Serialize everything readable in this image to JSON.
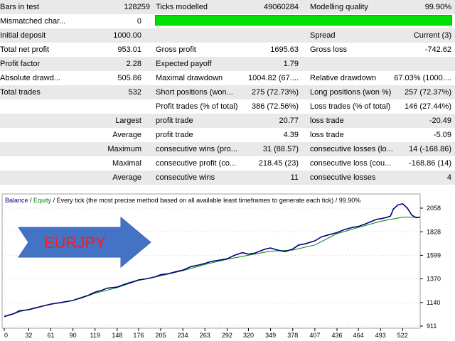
{
  "report": {
    "rows": [
      {
        "cells": [
          {
            "text": "Bars in test",
            "x": 0,
            "w": 200,
            "align": "l"
          },
          {
            "text": "128259",
            "x": 140,
            "w": 71,
            "align": "r"
          },
          {
            "text": "Ticks modelled",
            "x": 219,
            "w": 200,
            "align": "l"
          },
          {
            "text": "49060284",
            "x": 330,
            "w": 90,
            "align": "r"
          },
          {
            "text": "Modelling quality",
            "x": 436,
            "w": 200,
            "align": "l"
          },
          {
            "text": "99.90%",
            "x": 540,
            "w": 95,
            "align": "r"
          }
        ]
      },
      {
        "cells": [
          {
            "text": "Mismatched char...",
            "x": 0,
            "w": 200,
            "align": "l"
          },
          {
            "text": "0",
            "x": 140,
            "w": 59,
            "align": "r"
          }
        ]
      },
      {
        "cells": [
          {
            "text": "Initial deposit",
            "x": 0,
            "w": 200,
            "align": "l"
          },
          {
            "text": "1000.00",
            "x": 120,
            "w": 79,
            "align": "r"
          },
          {
            "text": "Spread",
            "x": 436,
            "w": 200,
            "align": "l"
          },
          {
            "text": "Current (3)",
            "x": 540,
            "w": 95,
            "align": "r"
          }
        ]
      },
      {
        "cells": [
          {
            "text": "Total net profit",
            "x": 0,
            "w": 200,
            "align": "l"
          },
          {
            "text": "953.01",
            "x": 120,
            "w": 79,
            "align": "r"
          },
          {
            "text": "Gross profit",
            "x": 219,
            "w": 200,
            "align": "l"
          },
          {
            "text": "1695.63",
            "x": 330,
            "w": 90,
            "align": "r"
          },
          {
            "text": "Gross loss",
            "x": 436,
            "w": 200,
            "align": "l"
          },
          {
            "text": "-742.62",
            "x": 540,
            "w": 95,
            "align": "r"
          }
        ]
      },
      {
        "cells": [
          {
            "text": "Profit factor",
            "x": 0,
            "w": 200,
            "align": "l"
          },
          {
            "text": "2.28",
            "x": 120,
            "w": 79,
            "align": "r"
          },
          {
            "text": "Expected payoff",
            "x": 219,
            "w": 200,
            "align": "l"
          },
          {
            "text": "1.79",
            "x": 330,
            "w": 90,
            "align": "r"
          }
        ]
      },
      {
        "cells": [
          {
            "text": "Absolute drawd...",
            "x": 0,
            "w": 200,
            "align": "l"
          },
          {
            "text": "505.86",
            "x": 120,
            "w": 79,
            "align": "r"
          },
          {
            "text": "Maximal drawdown",
            "x": 219,
            "w": 200,
            "align": "l"
          },
          {
            "text": "1004.82 (67....",
            "x": 320,
            "w": 100,
            "align": "r"
          },
          {
            "text": "Relative drawdown",
            "x": 436,
            "w": 200,
            "align": "l"
          },
          {
            "text": "67.03% (1000....",
            "x": 530,
            "w": 105,
            "align": "r"
          }
        ]
      },
      {
        "cells": [
          {
            "text": "Total trades",
            "x": 0,
            "w": 200,
            "align": "l"
          },
          {
            "text": "532",
            "x": 120,
            "w": 79,
            "align": "r"
          },
          {
            "text": "Short positions (won...",
            "x": 219,
            "w": 200,
            "align": "l"
          },
          {
            "text": "275 (72.73%)",
            "x": 320,
            "w": 100,
            "align": "r"
          },
          {
            "text": "Long positions (won %)",
            "x": 436,
            "w": 200,
            "align": "l"
          },
          {
            "text": "257 (72.37%)",
            "x": 530,
            "w": 105,
            "align": "r"
          }
        ]
      },
      {
        "cells": [
          {
            "text": "Profit trades (% of total)",
            "x": 219,
            "w": 200,
            "align": "l"
          },
          {
            "text": "386 (72.56%)",
            "x": 320,
            "w": 100,
            "align": "r"
          },
          {
            "text": "Loss trades (% of total)",
            "x": 436,
            "w": 200,
            "align": "l"
          },
          {
            "text": "146 (27.44%)",
            "x": 530,
            "w": 105,
            "align": "r"
          }
        ]
      },
      {
        "cells": [
          {
            "text": "Largest",
            "x": 100,
            "w": 99,
            "align": "r"
          },
          {
            "text": "profit trade",
            "x": 219,
            "w": 200,
            "align": "l"
          },
          {
            "text": "20.77",
            "x": 330,
            "w": 90,
            "align": "r"
          },
          {
            "text": "loss trade",
            "x": 436,
            "w": 200,
            "align": "l"
          },
          {
            "text": "-20.49",
            "x": 540,
            "w": 95,
            "align": "r"
          }
        ]
      },
      {
        "cells": [
          {
            "text": "Average",
            "x": 100,
            "w": 99,
            "align": "r"
          },
          {
            "text": "profit trade",
            "x": 219,
            "w": 200,
            "align": "l"
          },
          {
            "text": "4.39",
            "x": 330,
            "w": 90,
            "align": "r"
          },
          {
            "text": "loss trade",
            "x": 436,
            "w": 200,
            "align": "l"
          },
          {
            "text": "-5.09",
            "x": 540,
            "w": 95,
            "align": "r"
          }
        ]
      },
      {
        "cells": [
          {
            "text": "Maximum",
            "x": 100,
            "w": 99,
            "align": "r"
          },
          {
            "text": "consecutive wins (pro...",
            "x": 219,
            "w": 200,
            "align": "l"
          },
          {
            "text": "31 (88.57)",
            "x": 330,
            "w": 90,
            "align": "r"
          },
          {
            "text": "consecutive losses (lo...",
            "x": 436,
            "w": 200,
            "align": "l"
          },
          {
            "text": "14 (-168.86)",
            "x": 530,
            "w": 105,
            "align": "r"
          }
        ]
      },
      {
        "cells": [
          {
            "text": "Maximal",
            "x": 100,
            "w": 99,
            "align": "r"
          },
          {
            "text": "consecutive profit (co...",
            "x": 219,
            "w": 200,
            "align": "l"
          },
          {
            "text": "218.45 (23)",
            "x": 330,
            "w": 90,
            "align": "r"
          },
          {
            "text": "consecutive loss (cou...",
            "x": 436,
            "w": 200,
            "align": "l"
          },
          {
            "text": "-168.86 (14)",
            "x": 530,
            "w": 105,
            "align": "r"
          }
        ]
      },
      {
        "cells": [
          {
            "text": "Average",
            "x": 100,
            "w": 99,
            "align": "r"
          },
          {
            "text": "consecutive wins",
            "x": 219,
            "w": 200,
            "align": "l"
          },
          {
            "text": "11",
            "x": 330,
            "w": 90,
            "align": "r"
          },
          {
            "text": "consecutive losses",
            "x": 436,
            "w": 200,
            "align": "l"
          },
          {
            "text": "4",
            "x": 540,
            "w": 95,
            "align": "r"
          }
        ]
      }
    ],
    "quality_bar_color": "#00e000"
  },
  "chart_header": {
    "balance_label": "Balance",
    "separator": " / ",
    "equity_label": "Equity",
    "description": " / Every tick (the most precise method based on all available least timeframes to generate each tick) / 99.90%"
  },
  "overlay": {
    "label": "EURJPY",
    "arrow_color": "#4472c4",
    "label_color": "#ff1a1a"
  },
  "chart_data": {
    "type": "line",
    "x_ticks": [
      0,
      32,
      61,
      90,
      119,
      148,
      176,
      205,
      234,
      263,
      292,
      320,
      349,
      378,
      407,
      436,
      464,
      493,
      522
    ],
    "y_ticks": [
      911,
      1140,
      1370,
      1599,
      1828,
      2058
    ],
    "xlim": [
      0,
      545
    ],
    "ylim": [
      890,
      2120
    ],
    "balance_color": "#00007f",
    "equity_color": "#008000",
    "series": [
      {
        "name": "Balance",
        "x": [
          0,
          12,
          20,
          32,
          45,
          61,
          75,
          90,
          100,
          110,
          119,
          128,
          135,
          148,
          155,
          163,
          170,
          176,
          186,
          198,
          205,
          215,
          225,
          234,
          245,
          255,
          263,
          272,
          280,
          292,
          302,
          312,
          320,
          328,
          335,
          342,
          349,
          358,
          368,
          378,
          386,
          394,
          407,
          416,
          426,
          436,
          446,
          456,
          464,
          472,
          480,
          488,
          493,
          500,
          506,
          510,
          516,
          522,
          528,
          534,
          540,
          545
        ],
        "values": [
          1005,
          1030,
          1060,
          1070,
          1095,
          1125,
          1140,
          1160,
          1185,
          1210,
          1240,
          1260,
          1280,
          1290,
          1310,
          1330,
          1345,
          1360,
          1370,
          1390,
          1410,
          1420,
          1440,
          1455,
          1490,
          1505,
          1520,
          1540,
          1550,
          1565,
          1600,
          1625,
          1610,
          1620,
          1640,
          1660,
          1670,
          1650,
          1635,
          1660,
          1700,
          1710,
          1740,
          1780,
          1800,
          1820,
          1850,
          1870,
          1880,
          1900,
          1925,
          1950,
          1955,
          1965,
          1980,
          2050,
          2090,
          2100,
          2060,
          1990,
          1965,
          1970
        ]
      },
      {
        "name": "Equity",
        "x": [
          0,
          20,
          40,
          60,
          80,
          90,
          100,
          119,
          148,
          176,
          205,
          234,
          263,
          292,
          320,
          349,
          378,
          407,
          436,
          464,
          493,
          522,
          545
        ],
        "values": [
          1000,
          1050,
          1090,
          1120,
          1150,
          1160,
          1180,
          1230,
          1285,
          1355,
          1400,
          1450,
          1510,
          1560,
          1600,
          1640,
          1650,
          1700,
          1810,
          1870,
          1930,
          1970,
          1970
        ]
      }
    ]
  }
}
